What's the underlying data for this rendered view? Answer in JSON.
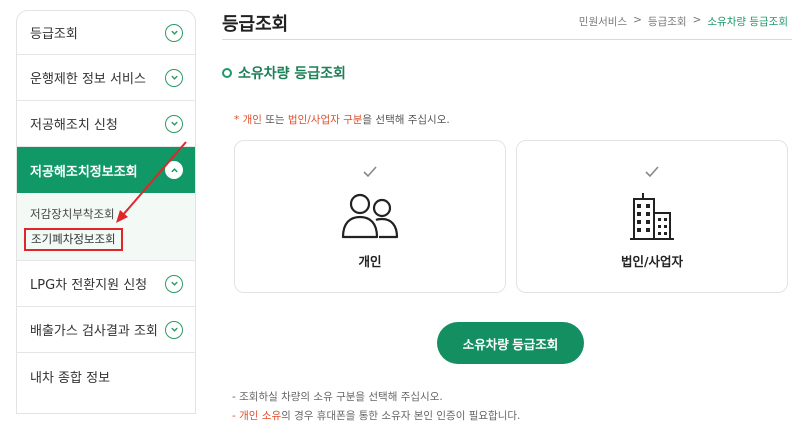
{
  "sidebar": {
    "items": [
      {
        "label": "등급조회"
      },
      {
        "label": "운행제한 정보 서비스"
      },
      {
        "label": "저공해조치 신청"
      },
      {
        "label": "저공해조치정보조회"
      },
      {
        "label": "LPG차 전환지원 신청"
      },
      {
        "label": "배출가스 검사결과 조회"
      },
      {
        "label": "내차 종합 정보"
      }
    ],
    "submenu": [
      {
        "label": "저감장치부착조회"
      },
      {
        "label": "조기폐차정보조회"
      }
    ]
  },
  "header": {
    "title": "등급조회",
    "breadcrumb": [
      "민원서비스",
      ">",
      "등급조회",
      ">",
      "소유차량 등급조회"
    ]
  },
  "section": {
    "title": "소유차량 등급조회"
  },
  "notice": {
    "star": "* ",
    "red1": "개인",
    "mid": " 또는 ",
    "red2": "법인/사업자 구분",
    "tail": "을 선택해 주십시오."
  },
  "cards": [
    {
      "label": "개인",
      "icon": "people-icon"
    },
    {
      "label": "법인/사업자",
      "icon": "building-icon"
    }
  ],
  "primary_button": "소유차량 등급조회",
  "footnotes": {
    "line1": "- 조회하실 차량의 소유 구분을 선택해 주십시오.",
    "line2_prefix": "- ",
    "line2_red": "개인 소유",
    "line2_tail": "의 경우 휴대폰을 통한 소유자 본인 인증이 필요합니다."
  },
  "colors": {
    "accent": "#109966",
    "highlight_red": "#e0262b"
  }
}
